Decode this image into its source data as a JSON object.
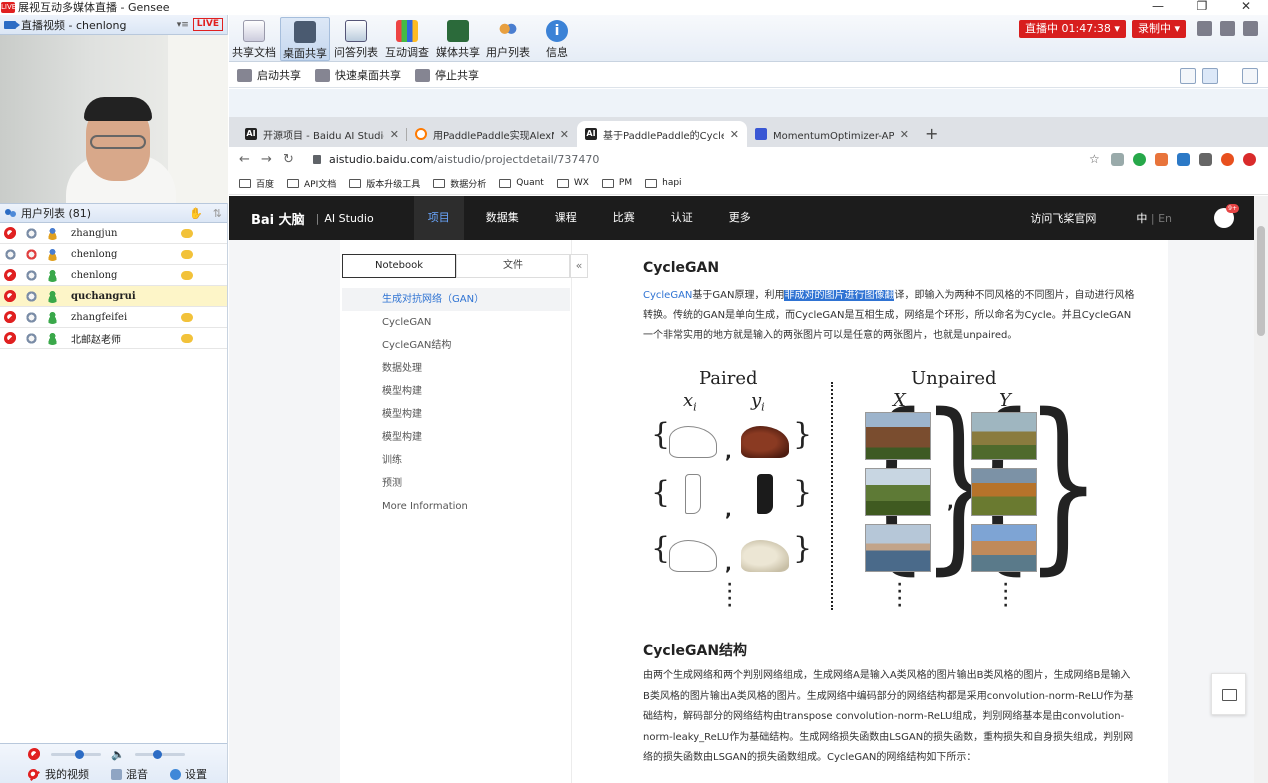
{
  "window": {
    "title": "展视互动多媒体直播 - Gensee",
    "app_icon": "LIVE"
  },
  "left": {
    "video_header": {
      "title": "直播视频 - chenlong",
      "menu": "▾≡",
      "live": "LIVE"
    },
    "userlist_header": {
      "title": "用户列表 (81)"
    },
    "users": [
      {
        "name": "zhangjun",
        "active": false
      },
      {
        "name": "chenlong",
        "active": false
      },
      {
        "name": "chenlong",
        "active": false
      },
      {
        "name": "quchangrui",
        "active": true
      },
      {
        "name": "zhangfeifei",
        "active": false
      },
      {
        "name": "北邮赵老师",
        "active": false
      }
    ],
    "bottom": {
      "my_video": "我的视频",
      "mix": "混音",
      "settings": "设置"
    }
  },
  "toolbar": {
    "buttons": [
      "共享文档",
      "桌面共享",
      "问答列表",
      "互动调查",
      "媒体共享",
      "用户列表",
      "信息"
    ],
    "active_index": 1,
    "live_status": "直播中  01:47:38 ▾",
    "record_status": "录制中 ▾"
  },
  "subbar": {
    "start": "启动共享",
    "quick": "快速桌面共享",
    "stop": "停止共享"
  },
  "browser": {
    "tabs": [
      {
        "label": "开源项目 - Baidu AI Studio - 人",
        "fav": "AI",
        "color": "#222"
      },
      {
        "label": "用PaddlePaddle实现AlexNet - ",
        "fav": "",
        "color": "#ff7a00"
      },
      {
        "label": "基于PaddlePaddle的CycleGAN",
        "fav": "AI",
        "color": "#222"
      },
      {
        "label": "MomentumOptimizer-API文档-",
        "fav": "",
        "color": "#3a57d4"
      }
    ],
    "active_tab": 2,
    "url_host": "aistudio.baidu.com",
    "url_path": "/aistudio/projectdetail/737470",
    "bookmarks": [
      "百度",
      "API文档",
      "版本升级工具",
      "数据分析",
      "Quant",
      "WX",
      "PM",
      "hapi"
    ]
  },
  "site": {
    "logo": "Bai 大脑",
    "logo_sub": "AI Studio",
    "nav": [
      "项目",
      "数据集",
      "课程",
      "比赛",
      "认证",
      "更多"
    ],
    "active_nav": 0,
    "official": "访问飞桨官网",
    "lang_zh": "中",
    "lang_sep": "|",
    "lang_en": "En",
    "badge": "9+"
  },
  "toc": {
    "tabs": [
      "Notebook",
      "文件"
    ],
    "collapse": "«",
    "items": [
      "生成对抗网络（GAN）",
      "CycleGAN",
      "CycleGAN结构",
      "数据处理",
      "模型构建",
      "模型构建",
      "模型构建",
      "训练",
      "预测",
      "More Information"
    ],
    "active_index": 0
  },
  "article": {
    "h1": "CycleGAN",
    "p1_link": "CycleGAN",
    "p1_a": "基于GAN原理，利用",
    "p1_hl": "非成对的图片进行图像翻",
    "p1_b": "译，即输入为两种不同风格的不同图片，自动进行风格转换。传统的GAN是单向生成，而CycleGAN是互相生成，网络是个环形，所以命名为Cycle。并且CycleGAN一个非常实用的地方就是输入的两张图片可以是任意的两张图片，也就是unpaired。",
    "figure": {
      "paired": "Paired",
      "unpaired": "Unpaired",
      "xi": "x",
      "xi_sub": "i",
      "yi": "y",
      "yi_sub": "i",
      "X": "X",
      "Y": "Y"
    },
    "h2": "CycleGAN结构",
    "p2": "由两个生成网络和两个判别网络组成，生成网络A是输入A类风格的图片输出B类风格的图片，生成网络B是输入B类风格的图片输出A类风格的图片。生成网络中编码部分的网络结构都是采用convolution-norm-ReLU作为基础结构，解码部分的网络结构由transpose convolution-norm-ReLU组成，判别网络基本是由convolution-norm-leaky_ReLU作为基础结构。生成网络损失函数由LSGAN的损失函数，重构损失和自身损失组成，判别网络的损失函数由LSGAN的损失函数组成。CycleGAN的网络结构如下所示："
  }
}
